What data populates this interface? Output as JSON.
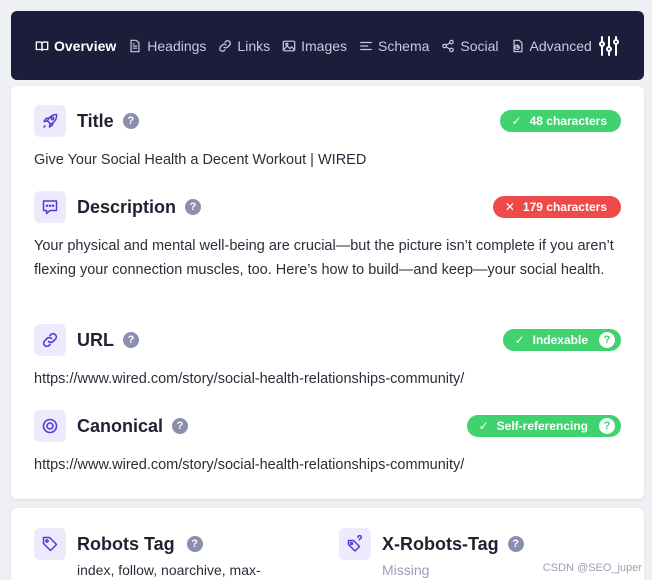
{
  "nav": {
    "items": [
      {
        "label": "Overview",
        "icon": "book-open-icon",
        "active": true
      },
      {
        "label": "Headings",
        "icon": "document-icon",
        "active": false
      },
      {
        "label": "Links",
        "icon": "link-icon",
        "active": false
      },
      {
        "label": "Images",
        "icon": "image-icon",
        "active": false
      },
      {
        "label": "Schema",
        "icon": "list-icon",
        "active": false
      },
      {
        "label": "Social",
        "icon": "share-icon",
        "active": false
      },
      {
        "label": "Advanced",
        "icon": "document-chart-icon",
        "active": false
      }
    ],
    "settings_icon": "sliders-icon"
  },
  "overview": {
    "title": {
      "label": "Title",
      "badge": "48 characters",
      "badge_status": "ok",
      "value": "Give Your Social Health a Decent Workout | WIRED"
    },
    "description": {
      "label": "Description",
      "badge": "179 characters",
      "badge_status": "bad",
      "value": "Your physical and mental well-being are crucial—but the picture isn’t complete if you aren’t flexing your connection muscles, too. Here’s how to build—and keep—your social health."
    },
    "url": {
      "label": "URL",
      "badge": "Indexable",
      "badge_status": "ok",
      "value": "https://www.wired.com/story/social-health-relationships-community/"
    },
    "canonical": {
      "label": "Canonical",
      "badge": "Self-referencing",
      "badge_status": "ok",
      "value": "https://www.wired.com/story/social-health-relationships-community/"
    }
  },
  "robots": {
    "robots_tag": {
      "label": "Robots Tag",
      "value": "index, follow, noarchive, max-"
    },
    "x_robots_tag": {
      "label": "X-Robots-Tag",
      "value": "Missing"
    }
  },
  "watermark": "CSDN @SEO_juper",
  "colors": {
    "nav_bg": "#1c1d3a",
    "accent": "#4f3fd6",
    "ok": "#3fd26e",
    "bad": "#ef4a4a"
  }
}
